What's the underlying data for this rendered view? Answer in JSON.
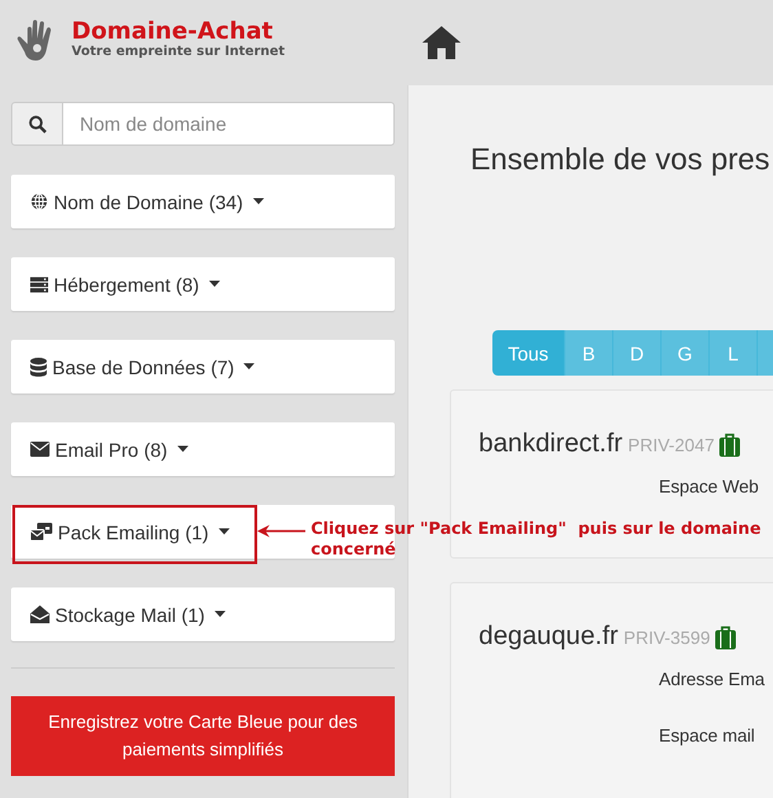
{
  "logo": {
    "name": "Domaine-Achat",
    "tagline": "Votre empreinte sur Internet"
  },
  "search": {
    "placeholder": "Nom de domaine"
  },
  "menu": [
    {
      "label": "Nom de Domaine (34)",
      "kind": "globe",
      "highlighted": false
    },
    {
      "label": "Hébergement (8)",
      "kind": "server",
      "highlighted": false
    },
    {
      "label": "Base de Données (7)",
      "kind": "database",
      "highlighted": false
    },
    {
      "label": "Email Pro (8)",
      "kind": "envelope",
      "highlighted": false
    },
    {
      "label": "Pack Emailing (1)",
      "kind": "pack",
      "highlighted": true
    },
    {
      "label": "Stockage Mail (1)",
      "kind": "inbox",
      "highlighted": false
    }
  ],
  "card_button": "Enregistrez votre Carte Bleue pour des paiements simplifiés",
  "annotation": "Cliquez sur \"Pack Emailing\"  puis sur le domaine concerné",
  "main": {
    "title": "Ensemble de vos pres",
    "filters": [
      {
        "label": "Tous",
        "selected": true
      },
      {
        "label": "B",
        "selected": false
      },
      {
        "label": "D",
        "selected": false
      },
      {
        "label": "G",
        "selected": false
      },
      {
        "label": "L",
        "selected": false
      }
    ],
    "cards": [
      {
        "domain": "bankdirect.fr",
        "ref": "PRIV-2047",
        "lines": [
          "Espace Web"
        ]
      },
      {
        "domain": "degauque.fr",
        "ref": "PRIV-3599",
        "lines": [
          "Adresse Ema",
          "Espace mail"
        ]
      }
    ]
  }
}
